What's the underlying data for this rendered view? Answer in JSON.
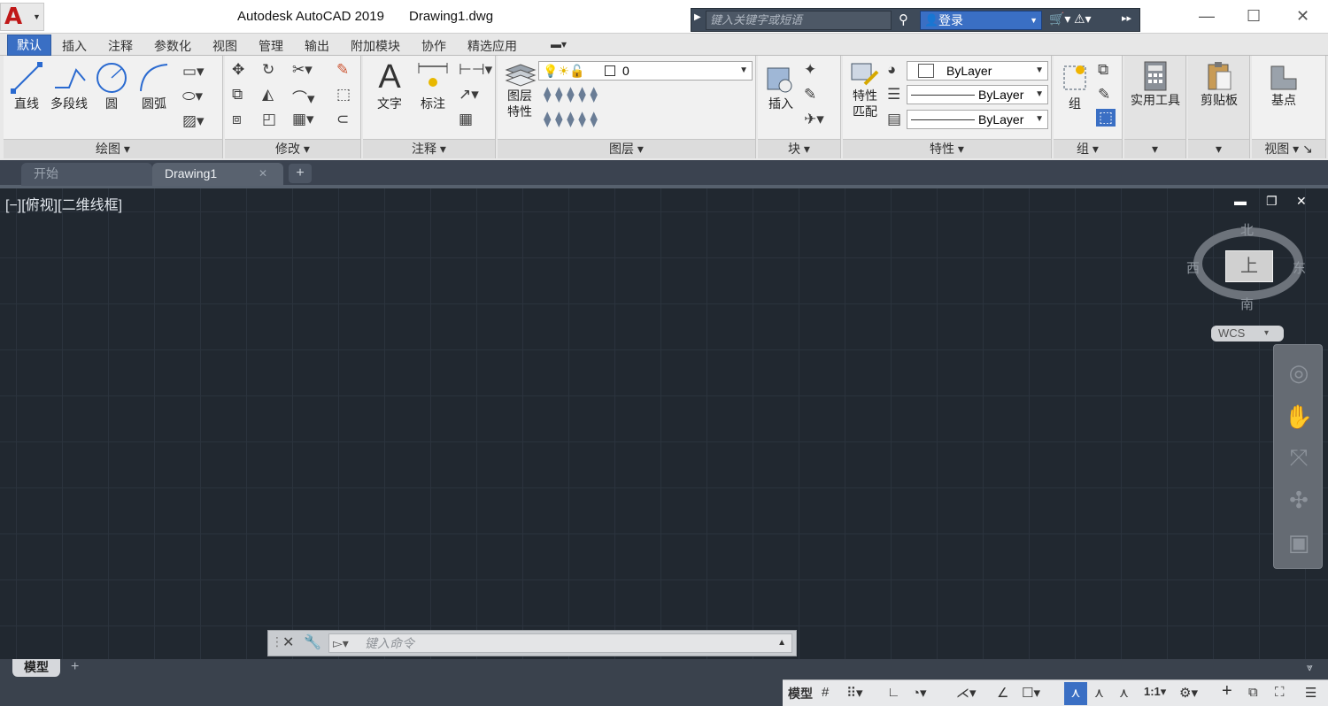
{
  "titlebar": {
    "app_name": "Autodesk AutoCAD 2019",
    "file_name": "Drawing1.dwg",
    "search_placeholder": "键入关键字或短语",
    "login_label": "登录",
    "minimize": "—",
    "maximize": "☐",
    "close": "✕"
  },
  "menu_tabs": [
    "默认",
    "插入",
    "注释",
    "参数化",
    "视图",
    "管理",
    "输出",
    "附加模块",
    "协作",
    "精选应用"
  ],
  "ribbon": {
    "draw": {
      "title": "绘图",
      "line": "直线",
      "polyline": "多段线",
      "circle": "圆",
      "arc": "圆弧"
    },
    "modify": {
      "title": "修改"
    },
    "annotation": {
      "title": "注释",
      "text": "文字",
      "dimension": "标注"
    },
    "layers": {
      "title": "图层",
      "layer_props_1": "图层",
      "layer_props_2": "特性",
      "current_layer": "0"
    },
    "block": {
      "title": "块",
      "insert": "插入"
    },
    "properties": {
      "title": "特性",
      "match_1": "特性",
      "match_2": "匹配",
      "color": "ByLayer",
      "linetype": "ByLayer",
      "lineweight": "ByLayer"
    },
    "groups": {
      "title": "组",
      "group": "组"
    },
    "utilities": {
      "title": "",
      "label": "实用工具"
    },
    "clipboard": {
      "title": "",
      "label": "剪贴板"
    },
    "view": {
      "title": "视图",
      "base": "基点"
    }
  },
  "doc_tabs": {
    "start": "开始",
    "drawing": "Drawing1"
  },
  "viewport": {
    "label": "[−][俯视][二维线框]",
    "cube_face": "上",
    "north": "北",
    "south": "南",
    "east": "东",
    "west": "西",
    "ucs": "WCS"
  },
  "command": {
    "placeholder": "键入命令"
  },
  "layout_tabs": {
    "model": "模型"
  },
  "status": {
    "model": "模型",
    "scale": "1:1"
  }
}
